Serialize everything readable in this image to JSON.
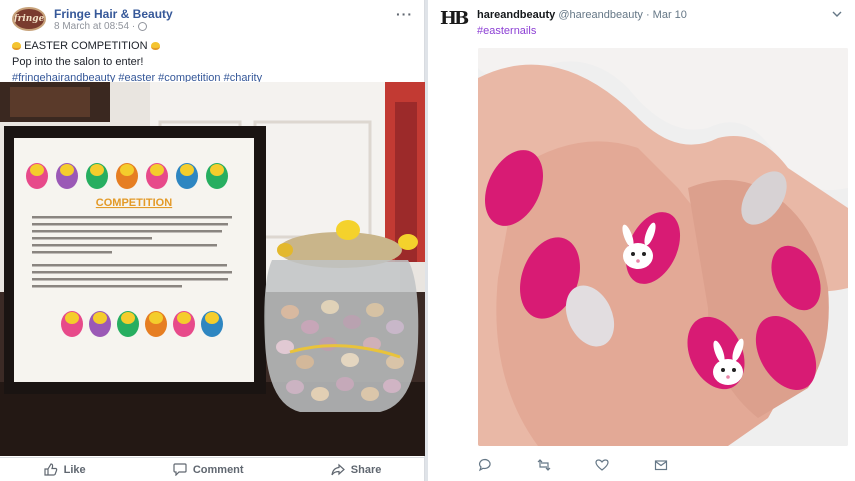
{
  "facebook": {
    "page_name": "Fringe Hair & Beauty",
    "avatar_text": "fringe",
    "timestamp": "8 March at 08:54 · ",
    "line1": "EASTER COMPETITION",
    "line2": "Pop into the salon to enter!",
    "hashtags": "#fringehairandbeauty #easter #competition #charity",
    "poster": {
      "heading": "COMPETITION",
      "body": "GUESS HOW MANY EGGS IN THE JAR? THE PERSON WITH THE CLOSEST GUESS WINS THE JAR PLUS A REDKEN SHAMPOO & CONDITIONER OF YOUR CHOICE. £1 A GO AND ALL DONATIONS WILL GO TO \"LITTLE PRINCESS TRUST\".",
      "body2": "THE LITTLE PRINCESS TRUST PROVIDE REAL HAIR WIGS FREE OF CHARGE TO CHILDREN ACROSS THE UK AND IRELAND THAT HAVE LOST THEIR OWN HAIR THROUGH CANCER TREATMENT."
    },
    "actions": {
      "like": "Like",
      "comment": "Comment",
      "share": "Share"
    }
  },
  "twitter": {
    "logo_text": "HB",
    "name": "hareandbeauty",
    "handle": "@hareandbeauty",
    "date": "· Mar 10",
    "hashtag": "#easternails"
  },
  "colors": {
    "fb_link": "#365899",
    "tw_hashtag": "#8c3fd4",
    "nail_pink": "#d81b74"
  }
}
